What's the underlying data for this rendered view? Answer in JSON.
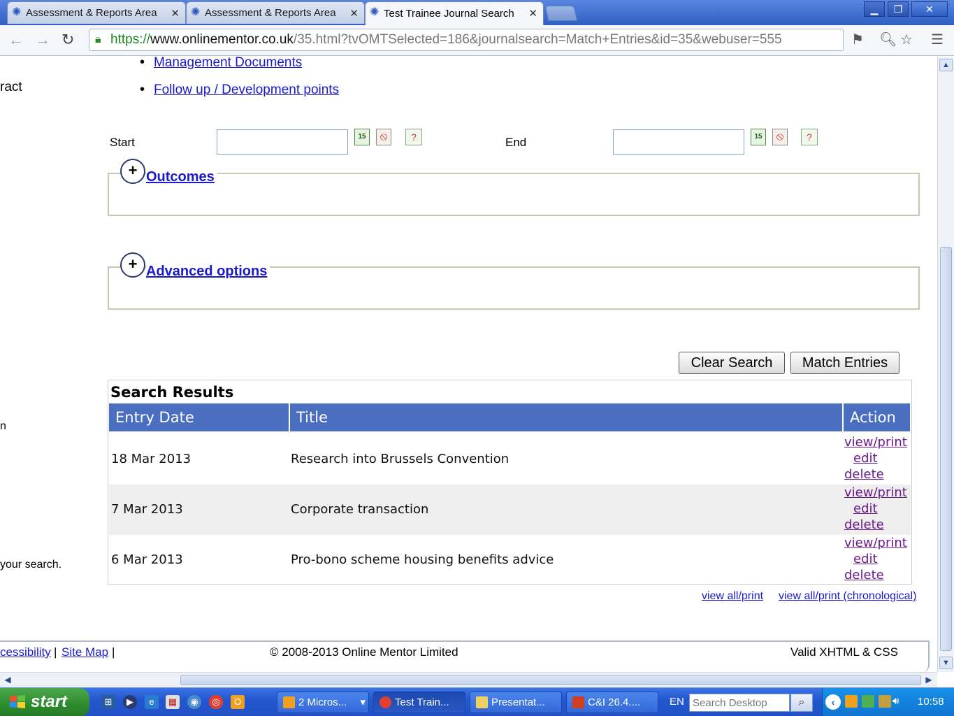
{
  "browser": {
    "tabs": [
      {
        "label": "Assessment & Reports Area",
        "active": false
      },
      {
        "label": "Assessment & Reports Area",
        "active": false
      },
      {
        "label": "Test Trainee Journal Search",
        "active": true
      }
    ],
    "url": {
      "scheme": "https://",
      "host": "www.onlinementor.co.uk",
      "path": "/35.html?tvOMTSelected=186&journalsearch=Match+Entries&id=35&webuser=555"
    },
    "window_buttons": {
      "minimize": "▁",
      "restore": "❐",
      "close": "✕"
    }
  },
  "page": {
    "nav_links": [
      "Management Documents",
      "Follow up / Development points"
    ],
    "left_fragments": [
      "ract",
      "n",
      "your search."
    ],
    "date_range": {
      "start_label": "Start",
      "end_label": "End",
      "start_value": "",
      "end_value": ""
    },
    "date_icon_text": {
      "calendar": "15",
      "clear": "⦸",
      "help": "?"
    },
    "sections": {
      "outcomes": "Outcomes",
      "advanced": "Advanced options"
    },
    "buttons": {
      "clear": "Clear Search",
      "match": "Match Entries"
    },
    "results": {
      "heading": "Search Results",
      "columns": [
        "Entry Date",
        "Title",
        "Action"
      ],
      "rows": [
        {
          "date": "18 Mar 2013",
          "title": "Research into Brussels Convention"
        },
        {
          "date": "7 Mar 2013",
          "title": "Corporate transaction"
        },
        {
          "date": "6 Mar 2013",
          "title": "Pro-bono scheme housing benefits advice"
        }
      ],
      "action_labels": {
        "view": "view/print",
        "edit": "edit",
        "delete": "delete"
      }
    },
    "view_links": {
      "all": "view all/print",
      "chronological": "view all/print (chronological)"
    },
    "footer": {
      "accessibility": "cessibility",
      "separator": "|",
      "sitemap": "Site Map",
      "copyright": "© 2008-2013 Online Mentor Limited",
      "valid": "Valid XHTML & CSS"
    }
  },
  "taskbar": {
    "start": "start",
    "tasks": [
      {
        "label": "2 Micros...",
        "icon_color": "#f0a020",
        "caret": "▾"
      },
      {
        "label": "Test Train...",
        "icon_color": "#e04030"
      },
      {
        "label": "Presentat...",
        "icon_color": "#f0d060"
      },
      {
        "label": "C&I 26.4....",
        "icon_color": "#d04020"
      }
    ],
    "language": "EN",
    "search_placeholder": "Search Desktop",
    "clock": "10:58"
  },
  "colors": {
    "accent": "#4a6ec0",
    "link": "#1a1acc",
    "visited_link": "#6a1a8a"
  }
}
